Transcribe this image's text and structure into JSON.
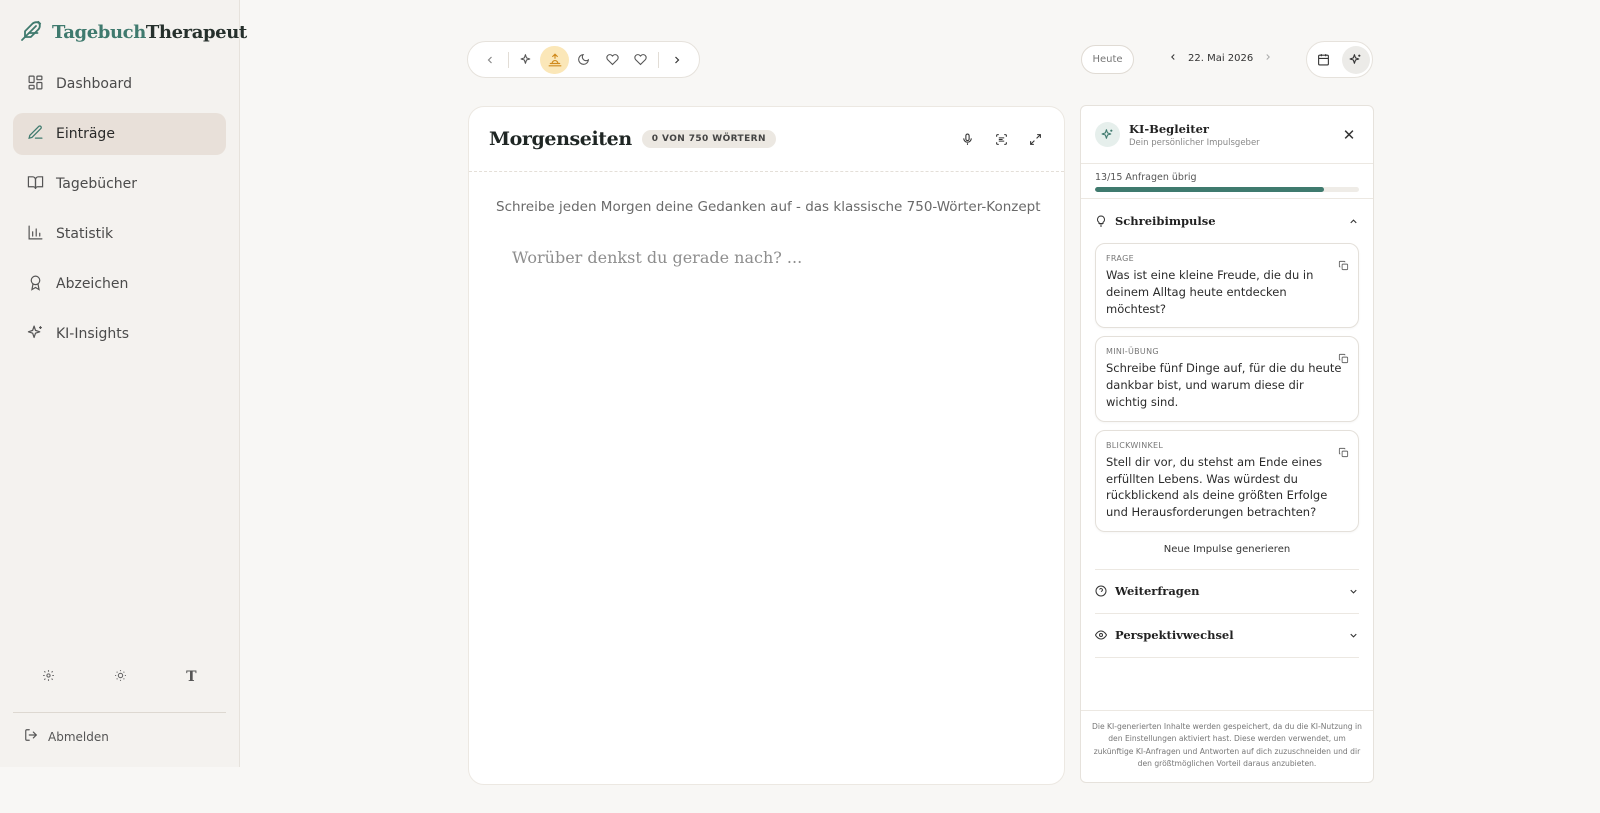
{
  "brand": {
    "part1": "Tagebuch",
    "part2": "Therapeut"
  },
  "nav": [
    {
      "label": "Dashboard",
      "icon": "dashboard-icon"
    },
    {
      "label": "Einträge",
      "icon": "pencil-icon",
      "active": true
    },
    {
      "label": "Tagebücher",
      "icon": "book-icon"
    },
    {
      "label": "Statistik",
      "icon": "chart-icon"
    },
    {
      "label": "Abzeichen",
      "icon": "award-icon"
    },
    {
      "label": "KI-Insights",
      "icon": "sparkles-icon"
    }
  ],
  "sidebar_footer": {
    "font_glyph": "T",
    "logout_label": "Abmelden"
  },
  "topbar": {
    "today_label": "Heute",
    "date": "22. Mai 2026"
  },
  "editor": {
    "title": "Morgenseiten",
    "word_count": "0 VON 750 WÖRTERN",
    "description": "Schreibe jeden Morgen deine Gedanken auf - das klassische 750-Wörter-Konzept",
    "placeholder": "Worüber denkst du gerade nach? ..."
  },
  "ai_panel": {
    "title": "KI-Begleiter",
    "subtitle": "Dein persönlicher Impulsgeber",
    "quota_text": "13/15 Anfragen übrig",
    "quota_used": 13,
    "quota_total": 15,
    "section_impulses": "Schreibimpulse",
    "cards": [
      {
        "kind": "FRAGE",
        "text": "Was ist eine kleine Freude, die du in deinem Alltag heute entdecken möchtest?"
      },
      {
        "kind": "MINI-ÜBUNG",
        "text": "Schreibe fünf Dinge auf, für die du heute dankbar bist, und warum diese dir wichtig sind."
      },
      {
        "kind": "BLICKWINKEL",
        "text": "Stell dir vor, du stehst am Ende eines erfüllten Lebens. Was würdest du rückblickend als deine größten Erfolge und Herausforderungen betrachten?"
      }
    ],
    "new_impulses_label": "Neue Impulse generieren",
    "section_followup": "Weiterfragen",
    "section_perspective": "Perspektivwechsel",
    "footer_note": "Die KI-generierten Inhalte werden gespeichert, da du die KI-Nutzung in den Einstellungen aktiviert hast. Diese werden verwendet, um zukünftige KI-Anfragen und Antworten auf dich zuzuschneiden und dir den größtmöglichen Vorteil daraus anzubieten."
  },
  "colors": {
    "accent": "#3f7a6e",
    "highlight": "#fbe7b8",
    "active_nav": "#e8e0d9"
  }
}
